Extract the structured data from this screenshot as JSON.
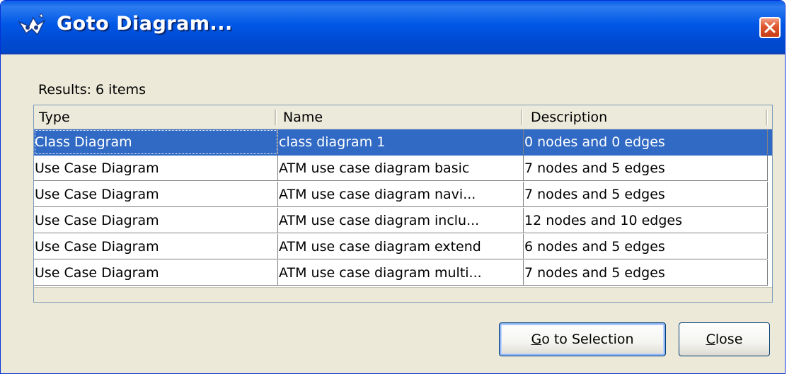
{
  "window": {
    "title": "Goto Diagram...",
    "icon": "argo-logo-icon",
    "close_icon": "close-icon"
  },
  "results_label": "Results: 6 items",
  "table": {
    "columns": [
      "Type",
      "Name",
      "Description"
    ],
    "rows": [
      {
        "type": "Class Diagram",
        "name": "class diagram 1",
        "description": "0 nodes and 0 edges",
        "selected": true
      },
      {
        "type": "Use Case Diagram",
        "name": "ATM use case diagram basic",
        "description": "7 nodes and 5 edges",
        "selected": false
      },
      {
        "type": "Use Case Diagram",
        "name": "ATM use case diagram navi...",
        "description": "7 nodes and 5 edges",
        "selected": false
      },
      {
        "type": "Use Case Diagram",
        "name": "ATM use case diagram inclu...",
        "description": "12 nodes and 10 edges",
        "selected": false
      },
      {
        "type": "Use Case Diagram",
        "name": "ATM use case diagram extend",
        "description": "6 nodes and 5 edges",
        "selected": false
      },
      {
        "type": "Use Case Diagram",
        "name": "ATM use case diagram multi...",
        "description": "7 nodes and 5 edges",
        "selected": false
      }
    ]
  },
  "buttons": {
    "goto": {
      "mnemonic": "G",
      "rest": "o to Selection"
    },
    "close": {
      "mnemonic": "C",
      "rest": "lose"
    }
  },
  "colors": {
    "titlebar": "#0058e6",
    "selection": "#316ac5",
    "dialog_bg": "#ece9d8"
  }
}
